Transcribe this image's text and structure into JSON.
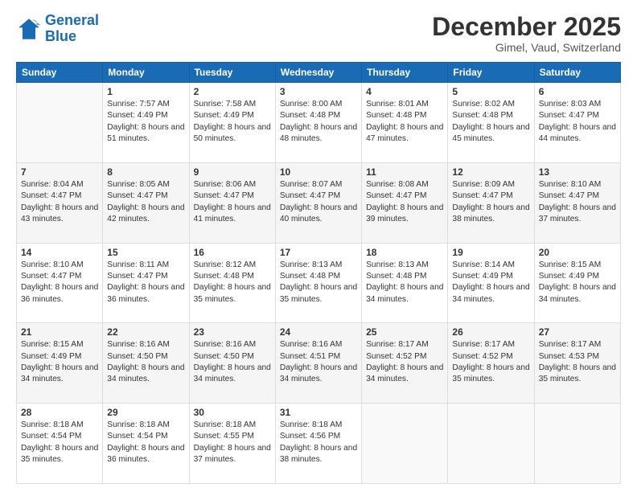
{
  "logo": {
    "line1": "General",
    "line2": "Blue"
  },
  "header": {
    "title": "December 2025",
    "subtitle": "Gimel, Vaud, Switzerland"
  },
  "weekdays": [
    "Sunday",
    "Monday",
    "Tuesday",
    "Wednesday",
    "Thursday",
    "Friday",
    "Saturday"
  ],
  "weeks": [
    [
      {
        "day": "",
        "sunrise": "",
        "sunset": "",
        "daylight": ""
      },
      {
        "day": "1",
        "sunrise": "Sunrise: 7:57 AM",
        "sunset": "Sunset: 4:49 PM",
        "daylight": "Daylight: 8 hours and 51 minutes."
      },
      {
        "day": "2",
        "sunrise": "Sunrise: 7:58 AM",
        "sunset": "Sunset: 4:49 PM",
        "daylight": "Daylight: 8 hours and 50 minutes."
      },
      {
        "day": "3",
        "sunrise": "Sunrise: 8:00 AM",
        "sunset": "Sunset: 4:48 PM",
        "daylight": "Daylight: 8 hours and 48 minutes."
      },
      {
        "day": "4",
        "sunrise": "Sunrise: 8:01 AM",
        "sunset": "Sunset: 4:48 PM",
        "daylight": "Daylight: 8 hours and 47 minutes."
      },
      {
        "day": "5",
        "sunrise": "Sunrise: 8:02 AM",
        "sunset": "Sunset: 4:48 PM",
        "daylight": "Daylight: 8 hours and 45 minutes."
      },
      {
        "day": "6",
        "sunrise": "Sunrise: 8:03 AM",
        "sunset": "Sunset: 4:47 PM",
        "daylight": "Daylight: 8 hours and 44 minutes."
      }
    ],
    [
      {
        "day": "7",
        "sunrise": "Sunrise: 8:04 AM",
        "sunset": "Sunset: 4:47 PM",
        "daylight": "Daylight: 8 hours and 43 minutes."
      },
      {
        "day": "8",
        "sunrise": "Sunrise: 8:05 AM",
        "sunset": "Sunset: 4:47 PM",
        "daylight": "Daylight: 8 hours and 42 minutes."
      },
      {
        "day": "9",
        "sunrise": "Sunrise: 8:06 AM",
        "sunset": "Sunset: 4:47 PM",
        "daylight": "Daylight: 8 hours and 41 minutes."
      },
      {
        "day": "10",
        "sunrise": "Sunrise: 8:07 AM",
        "sunset": "Sunset: 4:47 PM",
        "daylight": "Daylight: 8 hours and 40 minutes."
      },
      {
        "day": "11",
        "sunrise": "Sunrise: 8:08 AM",
        "sunset": "Sunset: 4:47 PM",
        "daylight": "Daylight: 8 hours and 39 minutes."
      },
      {
        "day": "12",
        "sunrise": "Sunrise: 8:09 AM",
        "sunset": "Sunset: 4:47 PM",
        "daylight": "Daylight: 8 hours and 38 minutes."
      },
      {
        "day": "13",
        "sunrise": "Sunrise: 8:10 AM",
        "sunset": "Sunset: 4:47 PM",
        "daylight": "Daylight: 8 hours and 37 minutes."
      }
    ],
    [
      {
        "day": "14",
        "sunrise": "Sunrise: 8:10 AM",
        "sunset": "Sunset: 4:47 PM",
        "daylight": "Daylight: 8 hours and 36 minutes."
      },
      {
        "day": "15",
        "sunrise": "Sunrise: 8:11 AM",
        "sunset": "Sunset: 4:47 PM",
        "daylight": "Daylight: 8 hours and 36 minutes."
      },
      {
        "day": "16",
        "sunrise": "Sunrise: 8:12 AM",
        "sunset": "Sunset: 4:48 PM",
        "daylight": "Daylight: 8 hours and 35 minutes."
      },
      {
        "day": "17",
        "sunrise": "Sunrise: 8:13 AM",
        "sunset": "Sunset: 4:48 PM",
        "daylight": "Daylight: 8 hours and 35 minutes."
      },
      {
        "day": "18",
        "sunrise": "Sunrise: 8:13 AM",
        "sunset": "Sunset: 4:48 PM",
        "daylight": "Daylight: 8 hours and 34 minutes."
      },
      {
        "day": "19",
        "sunrise": "Sunrise: 8:14 AM",
        "sunset": "Sunset: 4:49 PM",
        "daylight": "Daylight: 8 hours and 34 minutes."
      },
      {
        "day": "20",
        "sunrise": "Sunrise: 8:15 AM",
        "sunset": "Sunset: 4:49 PM",
        "daylight": "Daylight: 8 hours and 34 minutes."
      }
    ],
    [
      {
        "day": "21",
        "sunrise": "Sunrise: 8:15 AM",
        "sunset": "Sunset: 4:49 PM",
        "daylight": "Daylight: 8 hours and 34 minutes."
      },
      {
        "day": "22",
        "sunrise": "Sunrise: 8:16 AM",
        "sunset": "Sunset: 4:50 PM",
        "daylight": "Daylight: 8 hours and 34 minutes."
      },
      {
        "day": "23",
        "sunrise": "Sunrise: 8:16 AM",
        "sunset": "Sunset: 4:50 PM",
        "daylight": "Daylight: 8 hours and 34 minutes."
      },
      {
        "day": "24",
        "sunrise": "Sunrise: 8:16 AM",
        "sunset": "Sunset: 4:51 PM",
        "daylight": "Daylight: 8 hours and 34 minutes."
      },
      {
        "day": "25",
        "sunrise": "Sunrise: 8:17 AM",
        "sunset": "Sunset: 4:52 PM",
        "daylight": "Daylight: 8 hours and 34 minutes."
      },
      {
        "day": "26",
        "sunrise": "Sunrise: 8:17 AM",
        "sunset": "Sunset: 4:52 PM",
        "daylight": "Daylight: 8 hours and 35 minutes."
      },
      {
        "day": "27",
        "sunrise": "Sunrise: 8:17 AM",
        "sunset": "Sunset: 4:53 PM",
        "daylight": "Daylight: 8 hours and 35 minutes."
      }
    ],
    [
      {
        "day": "28",
        "sunrise": "Sunrise: 8:18 AM",
        "sunset": "Sunset: 4:54 PM",
        "daylight": "Daylight: 8 hours and 35 minutes."
      },
      {
        "day": "29",
        "sunrise": "Sunrise: 8:18 AM",
        "sunset": "Sunset: 4:54 PM",
        "daylight": "Daylight: 8 hours and 36 minutes."
      },
      {
        "day": "30",
        "sunrise": "Sunrise: 8:18 AM",
        "sunset": "Sunset: 4:55 PM",
        "daylight": "Daylight: 8 hours and 37 minutes."
      },
      {
        "day": "31",
        "sunrise": "Sunrise: 8:18 AM",
        "sunset": "Sunset: 4:56 PM",
        "daylight": "Daylight: 8 hours and 38 minutes."
      },
      {
        "day": "",
        "sunrise": "",
        "sunset": "",
        "daylight": ""
      },
      {
        "day": "",
        "sunrise": "",
        "sunset": "",
        "daylight": ""
      },
      {
        "day": "",
        "sunrise": "",
        "sunset": "",
        "daylight": ""
      }
    ]
  ]
}
